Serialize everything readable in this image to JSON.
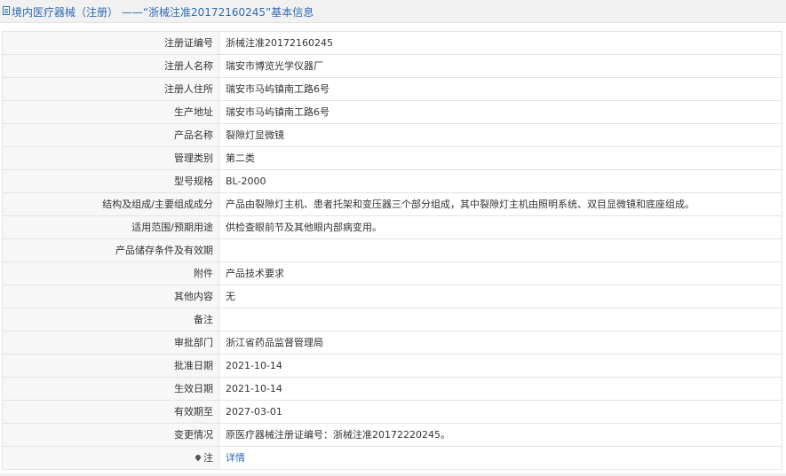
{
  "header": {
    "title": "境内医疗器械（注册） ——“浙械注准20172160245”基本信息"
  },
  "rows": [
    {
      "label": "注册证编号",
      "value": "浙械注准20172160245"
    },
    {
      "label": "注册人名称",
      "value": "瑞安市博览光学仪器厂"
    },
    {
      "label": "注册人住所",
      "value": "瑞安市马屿镇南工路6号"
    },
    {
      "label": "生产地址",
      "value": "瑞安市马屿镇南工路6号"
    },
    {
      "label": "产品名称",
      "value": "裂隙灯显微镜"
    },
    {
      "label": "管理类别",
      "value": "第二类"
    },
    {
      "label": "型号规格",
      "value": "BL-2000"
    },
    {
      "label": "结构及组成/主要组成成分",
      "value": "产品由裂隙灯主机、患者托架和变压器三个部分组成，其中裂隙灯主机由照明系统、双目显微镜和底座组成。"
    },
    {
      "label": "适用范围/预期用途",
      "value": "供检查眼前节及其他眼内部病变用。"
    },
    {
      "label": "产品储存条件及有效期",
      "value": ""
    },
    {
      "label": "附件",
      "value": "产品技术要求"
    },
    {
      "label": "其他内容",
      "value": "无"
    },
    {
      "label": "备注",
      "value": ""
    },
    {
      "label": "审批部门",
      "value": "浙江省药品监督管理局"
    },
    {
      "label": "批准日期",
      "value": "2021-10-14"
    },
    {
      "label": "生效日期",
      "value": "2021-10-14"
    },
    {
      "label": "有效期至",
      "value": "2027-03-01"
    },
    {
      "label": "变更情况",
      "value": "原医疗器械注册证编号：浙械注准20172220245。"
    }
  ],
  "note_row": {
    "label": "注",
    "link_text": "详情",
    "icon": "pin-icon"
  },
  "colors": {
    "accent": "#2e6bb0",
    "label_bg": "#f7f7f7",
    "border": "#e3e3e3"
  }
}
